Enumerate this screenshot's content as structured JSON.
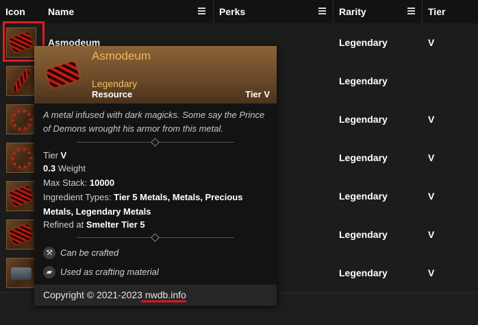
{
  "table": {
    "columns": [
      {
        "label": "Icon"
      },
      {
        "label": "Name"
      },
      {
        "label": "Perks"
      },
      {
        "label": "Rarity"
      },
      {
        "label": "Tier"
      }
    ],
    "rows": [
      {
        "name": "Asmodeum",
        "rarity": "Legendary",
        "tier": "V",
        "icon": "asmodeum-ore-icon"
      },
      {
        "name": "",
        "rarity": "Legendary",
        "tier": "",
        "icon": "red-blade-icon"
      },
      {
        "name": "",
        "rarity": "Legendary",
        "tier": "V",
        "icon": "red-chain-icon"
      },
      {
        "name": "",
        "rarity": "Legendary",
        "tier": "V",
        "icon": "red-chain-icon"
      },
      {
        "name": "",
        "rarity": "Legendary",
        "tier": "V",
        "icon": "red-ore-icon"
      },
      {
        "name": "",
        "rarity": "Legendary",
        "tier": "V",
        "icon": "red-ore-icon"
      },
      {
        "name": "",
        "rarity": "Legendary",
        "tier": "V",
        "icon": "gray-ingot-icon"
      }
    ]
  },
  "tooltip": {
    "title": "Asmodeum",
    "rarity": "Legendary",
    "type": "Resource",
    "tier": "Tier V",
    "description": "A metal infused with dark magicks. Some say the Prince of Demons wrought his armor from this metal.",
    "stats": {
      "tier_label": "Tier",
      "tier_value": "V",
      "weight_value": "0.3",
      "weight_label": "Weight",
      "maxstack_label": "Max Stack:",
      "maxstack_value": "10000",
      "ingredient_label": "Ingredient Types:",
      "ingredient_value": "Tier 5 Metals, Metals, Precious Metals, Legendary Metals",
      "refined_label": "Refined at",
      "refined_value": "Smelter Tier 5"
    },
    "features": [
      {
        "label": "Can be crafted",
        "icon": "hammer-icon"
      },
      {
        "label": "Used as crafting material",
        "icon": "ingot-icon"
      }
    ],
    "footer": {
      "copyright": "Copyright © 2021-2023",
      "site": "nwdb.info"
    }
  },
  "colors": {
    "rarity_gold": "#f4c064",
    "highlight_red": "#e11d20",
    "header_bg": "#121212"
  }
}
